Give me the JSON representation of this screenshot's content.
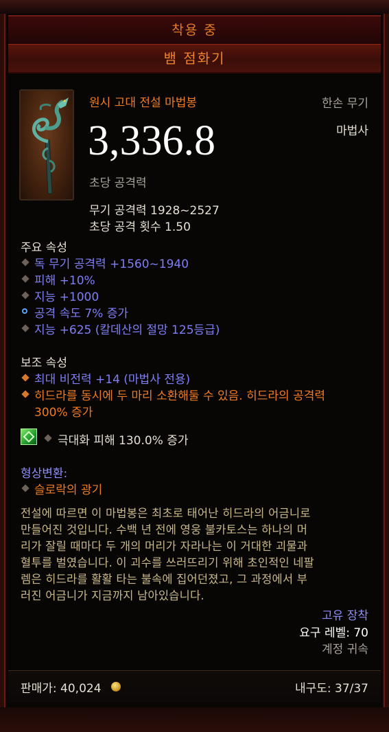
{
  "header": {
    "equipped_label": "착용 중",
    "item_name": "뱀 점화기"
  },
  "item": {
    "icon": "serpent-wand-icon",
    "quality_type": "원시 고대 전설 마법봉",
    "slot": "한손 무기",
    "class": "마법사",
    "dps_value": "3,336.8",
    "dps_label": "초당 공격력",
    "weapon_damage": "무기 공격력 1928~2527",
    "attacks_per_second": "초당 공격 횟수 1.50"
  },
  "primary": {
    "title": "주요 속성",
    "stats": [
      "독 무기 공격력 +1560~1940",
      "피해 +10%",
      "지능 +1000",
      "공격 속도 7% 증가",
      "지능 +625 (칼데산의 절망 125등급)"
    ]
  },
  "secondary": {
    "title": "보조 속성",
    "stats": [
      "최대 비전력 +14 (마법사 전용)",
      "히드라를 동시에 두 마리 소환해둘 수 있음. 히드라의 공격력",
      "300% 증가"
    ]
  },
  "gem_socket": {
    "icon": "green-gem-icon",
    "text": "극대화 피해 130.0% 증가"
  },
  "transmog": {
    "title": "형상변환:",
    "value": "슬로락의 광기"
  },
  "lore": [
    "전설에 따르면 이 마법봉은 최초로 태어난 히드라의 어금니로",
    "만들어진 것입니다. 수백 년 전에 영웅 불카토스는 하나의 머",
    "리가 잘릴 때마다 두 개의 머리가 자라나는 이 거대한 괴물과",
    "혈투를 벌였습니다. 이 괴수를 쓰러뜨리기 위해 초인적인 네팔",
    "렘은 히드라를 활활 타는 불속에 집어던졌고, 그 과정에서 부",
    "러진 어금니가 지금까지 남아있습니다."
  ],
  "meta": {
    "binding_type": "고유 장착",
    "required_level": "요구 레벨: 70",
    "account_bound": "계정 귀속"
  },
  "footer": {
    "sell_value": "판매가: 40,024",
    "durability": "내구도: 37/37"
  },
  "colors": {
    "legendary_orange": "#ef7c22",
    "magic_blue": "#7f7ff3",
    "frame_red": "#6a1a10"
  }
}
